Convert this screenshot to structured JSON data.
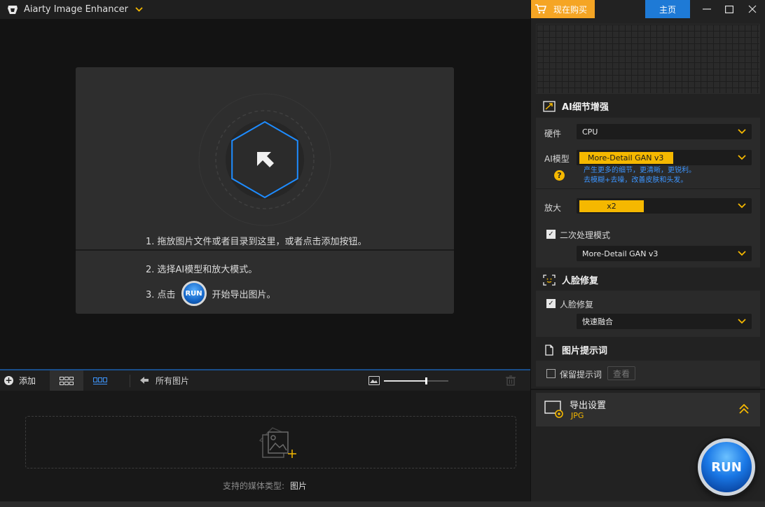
{
  "app": {
    "title": "Aiarty Image Enhancer"
  },
  "window": {
    "buy_label": "现在购买",
    "home_label": "主页"
  },
  "drop_area": {
    "step1": "1. 拖放图片文件或者目录到这里，或者点击添加按钮。",
    "step2": "2. 选择AI模型和放大模式。",
    "step3_prefix": "3. 点击",
    "step3_suffix": "开始导出图片。",
    "run_label": "RUN"
  },
  "toolbar": {
    "add_label": "添加",
    "all_images_label": "所有图片",
    "zoom_level": 0.65
  },
  "bottom": {
    "supported_label": "支持的媒体类型:",
    "supported_value": "图片"
  },
  "ai_detail": {
    "title": "AI细节增强",
    "hardware_label": "硬件",
    "hardware_value": "CPU",
    "model_label": "AI模型",
    "model_value": "More-Detail GAN  v3",
    "model_desc_line1": "产生更多的细节，更清晰，更锐利。",
    "model_desc_line2": "去模糊+去噪，改善皮肤和头发。",
    "scale_label": "放大",
    "scale_value": "x2",
    "second_pass_label": "二次处理模式",
    "second_pass_checked": true,
    "second_pass_value": "More-Detail GAN  v3"
  },
  "face": {
    "title": "人脸修复",
    "checkbox_label": "人脸修复",
    "checked": true,
    "mode_value": "快速融合"
  },
  "prompt": {
    "title": "图片提示词",
    "keep_label": "保留提示词",
    "keep_checked": false,
    "view_label": "查看"
  },
  "export": {
    "title": "导出设置",
    "format": "JPG"
  },
  "run_button": {
    "label": "RUN"
  },
  "colors": {
    "accent_orange": "#f5a524",
    "accent_yellow": "#f5b800",
    "accent_blue": "#1e7ad6"
  }
}
